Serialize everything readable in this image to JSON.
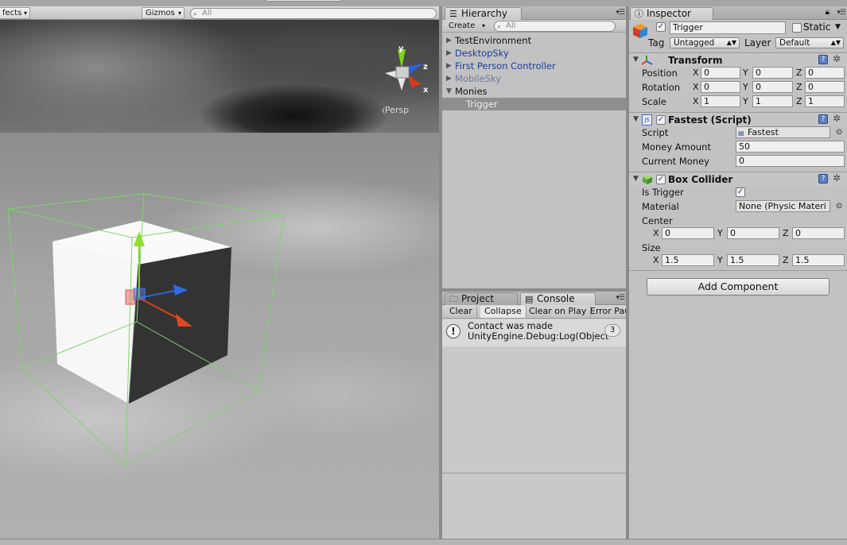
{
  "scene": {
    "effects_label": "fects",
    "gizmos_label": "Gizmos",
    "search_placeholder": "All",
    "persp_label": "Persp",
    "axis_y": "y",
    "axis_z": "z",
    "axis_x": "x"
  },
  "hierarchy": {
    "tab_label": "Hierarchy",
    "create_label": "Create",
    "search_placeholder": "All",
    "items": [
      {
        "label": "TestEnvironment"
      },
      {
        "label": "DesktopSky"
      },
      {
        "label": "First Person Controller"
      },
      {
        "label": "MobileSky"
      },
      {
        "label": "Monies"
      },
      {
        "label": "Trigger"
      }
    ]
  },
  "console": {
    "project_tab": "Project",
    "console_tab": "Console",
    "clear": "Clear",
    "collapse": "Collapse",
    "clear_on_play": "Clear on Play",
    "error_pause": "Error Pau",
    "log_line1": "Contact was made",
    "log_line2": "UnityEngine.Debug:Log(Object)",
    "log_count": "3"
  },
  "inspector": {
    "tab_label": "Inspector",
    "object_name": "Trigger",
    "static_label": "Static",
    "tag_label": "Tag",
    "tag_value": "Untagged",
    "layer_label": "Layer",
    "layer_value": "Default",
    "transform": {
      "title": "Transform",
      "position_label": "Position",
      "rotation_label": "Rotation",
      "scale_label": "Scale",
      "x": "X",
      "y": "Y",
      "z": "Z",
      "pos": [
        "0",
        "0",
        "0"
      ],
      "rot": [
        "0",
        "0",
        "0"
      ],
      "scl": [
        "1",
        "1",
        "1"
      ]
    },
    "script": {
      "title": "Fastest (Script)",
      "script_label": "Script",
      "script_value": "Fastest",
      "money_amount_label": "Money Amount",
      "money_amount_value": "50",
      "current_money_label": "Current Money",
      "current_money_value": "0"
    },
    "box_collider": {
      "title": "Box Collider",
      "is_trigger_label": "Is Trigger",
      "material_label": "Material",
      "material_value": "None (Physic Materi",
      "center_label": "Center",
      "size_label": "Size",
      "center": [
        "0",
        "0",
        "0"
      ],
      "size": [
        "1.5",
        "1.5",
        "1.5"
      ]
    },
    "add_component": "Add Component"
  }
}
